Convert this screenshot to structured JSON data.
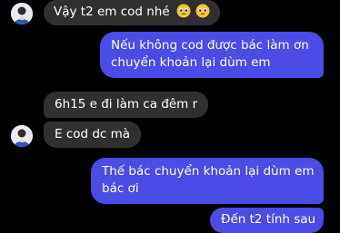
{
  "messages": [
    {
      "id": "m1",
      "side": "in",
      "text": "Vậy t2 em cod nhé",
      "emoji": [
        "pleading-face",
        "pleading-face"
      ]
    },
    {
      "id": "m2",
      "side": "out",
      "lines": [
        "Nếu không cod được bác làm ơn",
        "chuyển khoản lại dùm em"
      ]
    },
    {
      "id": "m3",
      "side": "in",
      "text": "6h15 e đi làm ca đêm r"
    },
    {
      "id": "m4",
      "side": "in",
      "text": "E cod dc mà"
    },
    {
      "id": "m5",
      "side": "out",
      "lines": [
        "Thế bác chuyển khoản lại dùm em",
        "bác ơi"
      ]
    },
    {
      "id": "m6",
      "side": "out",
      "text": "Đến t2 tính sau"
    }
  ],
  "colors": {
    "background": "#000000",
    "incoming_bubble": "#303030",
    "outgoing_bubble": "#4b4be6",
    "text": "#ffffff"
  },
  "icons": {
    "avatar": "contact-avatar-icon",
    "emoji": "pleading-face-emoji"
  }
}
